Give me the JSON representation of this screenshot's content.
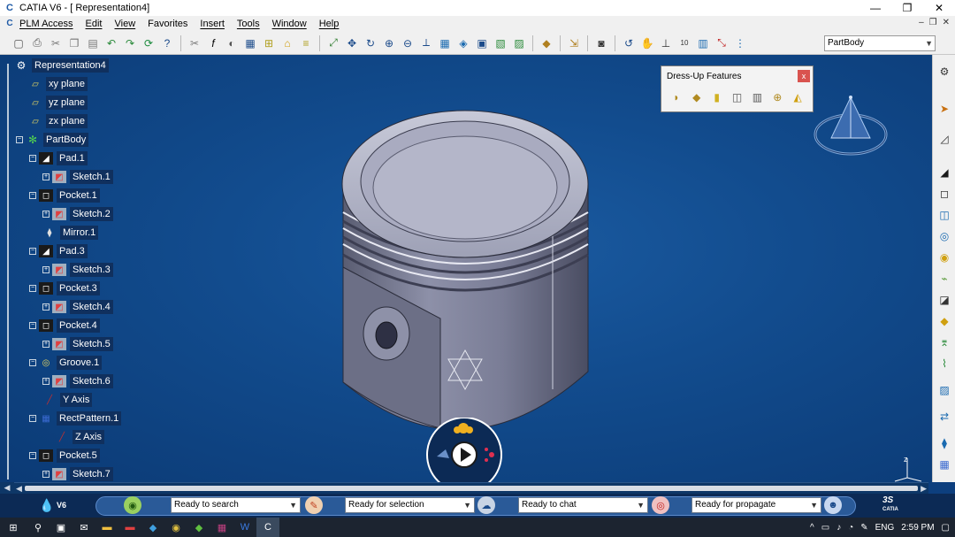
{
  "window": {
    "title": "CATIA V6 - [ Representation4]",
    "minimize": "—",
    "restore": "❐",
    "close": "✕"
  },
  "menu": {
    "items": [
      "PLM Access",
      "Edit",
      "View",
      "Favorites",
      "Insert",
      "Tools",
      "Window",
      "Help"
    ]
  },
  "toolbar": {
    "body_selector": "PartBody"
  },
  "tree": {
    "root": "Representation4",
    "nodes": [
      {
        "label": "xy plane"
      },
      {
        "label": "yz plane"
      },
      {
        "label": "zx plane"
      },
      {
        "label": "PartBody"
      },
      {
        "label": "Pad.1"
      },
      {
        "label": "Sketch.1"
      },
      {
        "label": "Pocket.1"
      },
      {
        "label": "Sketch.2"
      },
      {
        "label": "Mirror.1"
      },
      {
        "label": "Pad.3"
      },
      {
        "label": "Sketch.3"
      },
      {
        "label": "Pocket.3"
      },
      {
        "label": "Sketch.4"
      },
      {
        "label": "Pocket.4"
      },
      {
        "label": "Sketch.5"
      },
      {
        "label": "Groove.1"
      },
      {
        "label": "Sketch.6"
      },
      {
        "label": "Y Axis"
      },
      {
        "label": "RectPattern.1"
      },
      {
        "label": "Z Axis"
      },
      {
        "label": "Pocket.5"
      },
      {
        "label": "Sketch.7"
      }
    ]
  },
  "dressup": {
    "title": "Dress-Up Features",
    "close": "x"
  },
  "powerbar": {
    "logo": "V6",
    "fields": [
      "Ready to search",
      "Ready for selection",
      "Ready to chat",
      "Ready for propagate"
    ],
    "brand": "CATIA"
  },
  "taskbar": {
    "lang": "ENG",
    "time": "2:59 PM"
  },
  "compass": {
    "axis": "z"
  }
}
